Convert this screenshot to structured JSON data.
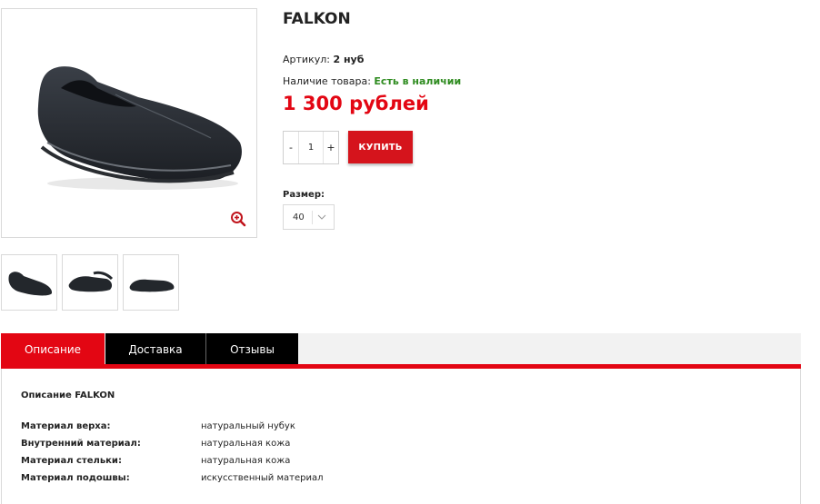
{
  "product": {
    "title": "FALKON",
    "sku_label": "Артикул:",
    "sku_value": "2 нуб",
    "stock_label": "Наличие товара:",
    "stock_value": "Есть в наличии",
    "price": "1 300 рублей"
  },
  "quantity": {
    "minus_label": "-",
    "value": "1",
    "plus_label": "+"
  },
  "buy_button": {
    "label": "КУПИТЬ"
  },
  "size": {
    "label": "Размер:",
    "selected": "40"
  },
  "tabs": [
    {
      "label": "Описание",
      "active": true
    },
    {
      "label": "Доставка",
      "active": false
    },
    {
      "label": "Отзывы",
      "active": false
    }
  ],
  "description": {
    "title": "Описание FALKON",
    "specs": [
      {
        "key": "Материал верха:",
        "value": "натуральный нубук"
      },
      {
        "key": "Внутренний материал:",
        "value": "натуральная кожа"
      },
      {
        "key": "Материал стельки:",
        "value": "натуральная кожа"
      },
      {
        "key": "Материал подошвы:",
        "value": "искусственный материал"
      }
    ]
  },
  "icons": {
    "zoom": "zoom-in-icon",
    "size_dropdown": "chevron-down-icon"
  },
  "colors": {
    "accent": "#e30613",
    "buy_button": "#d5141c",
    "in_stock": "#2e8b1f",
    "tab_inactive": "#000000"
  }
}
